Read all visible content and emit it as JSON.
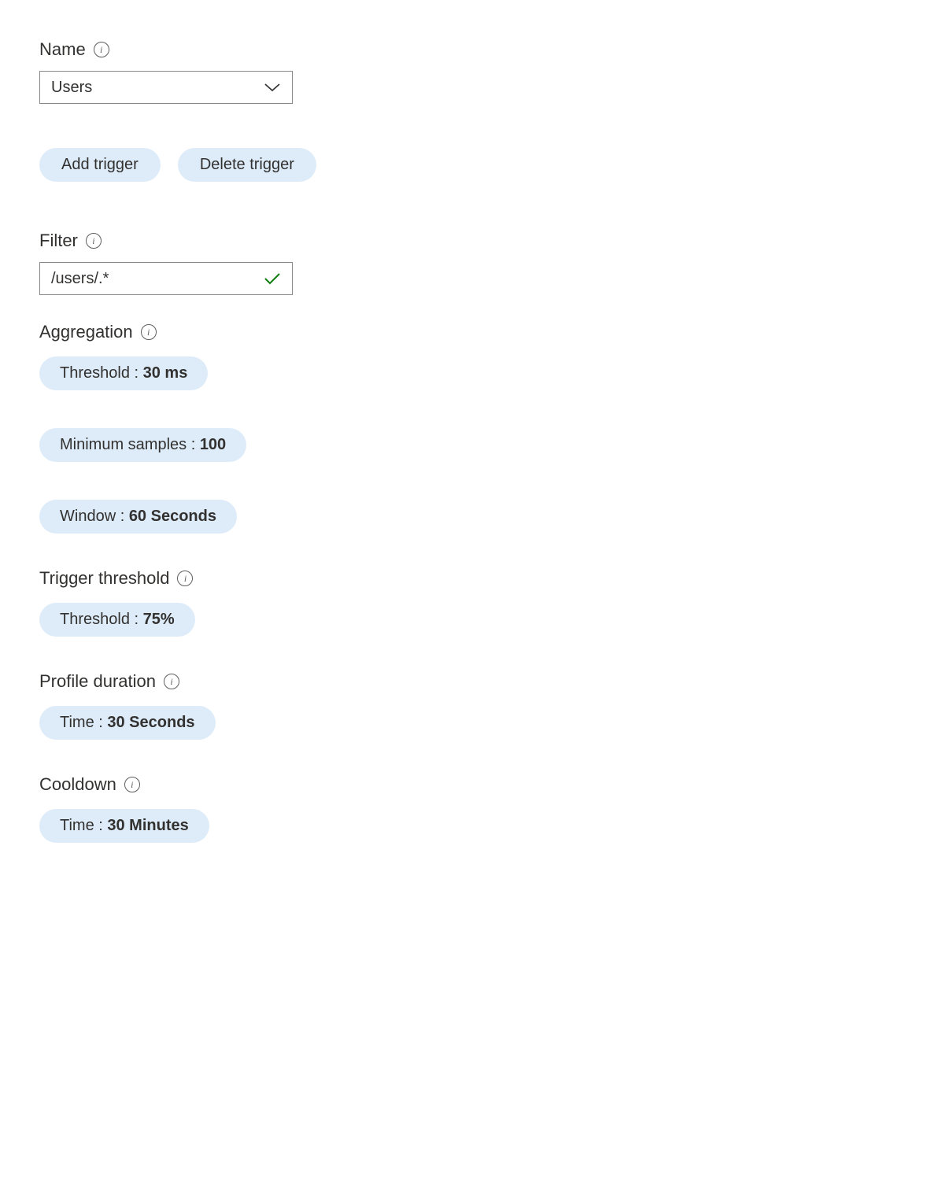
{
  "name": {
    "label": "Name",
    "value": "Users"
  },
  "buttons": {
    "add_trigger": "Add trigger",
    "delete_trigger": "Delete trigger"
  },
  "filter": {
    "label": "Filter",
    "value": "/users/.*"
  },
  "aggregation": {
    "label": "Aggregation",
    "threshold_label": "Threshold : ",
    "threshold_value": "30 ms",
    "min_samples_label": "Minimum samples : ",
    "min_samples_value": "100",
    "window_label": "Window : ",
    "window_value": "60 Seconds"
  },
  "trigger_threshold": {
    "label": "Trigger threshold",
    "threshold_label": "Threshold : ",
    "threshold_value": "75%"
  },
  "profile_duration": {
    "label": "Profile duration",
    "time_label": "Time : ",
    "time_value": "30 Seconds"
  },
  "cooldown": {
    "label": "Cooldown",
    "time_label": "Time : ",
    "time_value": "30 Minutes"
  }
}
